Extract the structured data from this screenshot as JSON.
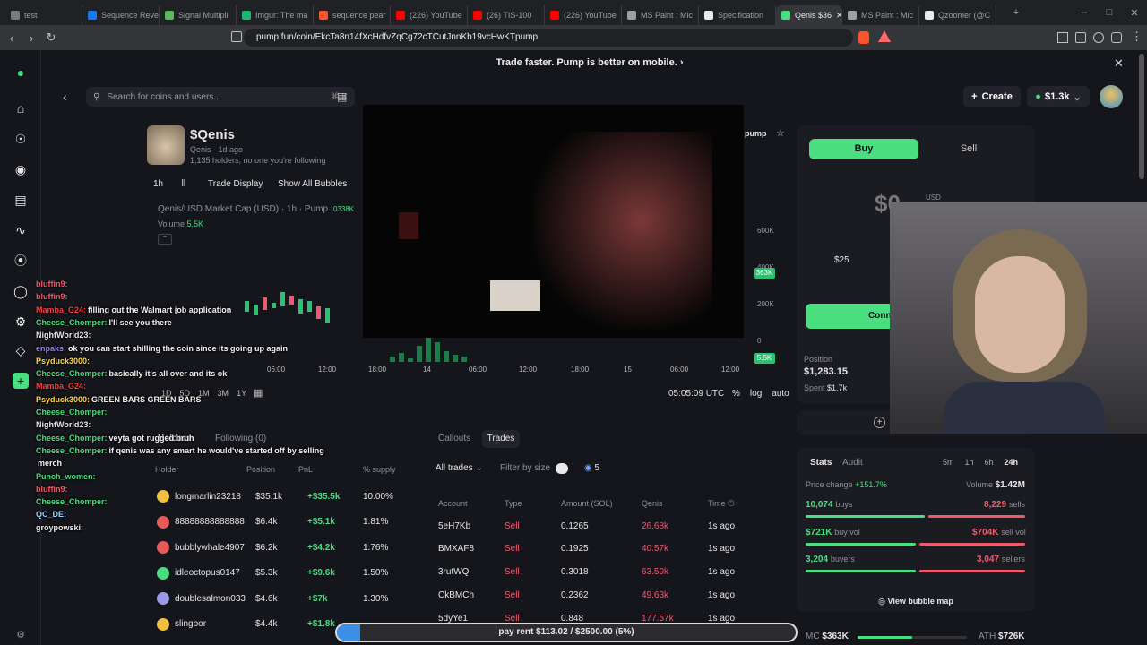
{
  "browser": {
    "tabs": [
      {
        "label": "test",
        "color": "#7a7a7a"
      },
      {
        "label": "Sequence Reve",
        "color": "#1877f2"
      },
      {
        "label": "Signal Multipli",
        "color": "#5cb85c"
      },
      {
        "label": "Imgur: The ma",
        "color": "#1bb76e"
      },
      {
        "label": "sequence pear",
        "color": "#fb542b"
      },
      {
        "label": "(226) YouTube",
        "color": "#ff0000"
      },
      {
        "label": "(26) TIS-100",
        "color": "#ff0000"
      },
      {
        "label": "(226) YouTube",
        "color": "#ff0000"
      },
      {
        "label": "MS Paint : Mic",
        "color": "#9aa0a6"
      },
      {
        "label": "Specification",
        "color": "#e8eaed"
      },
      {
        "label": "Qenis $36",
        "color": "#4ade80"
      },
      {
        "label": "MS Paint : Mic",
        "color": "#9aa0a6"
      },
      {
        "label": "Qzoomer (@C",
        "color": "#e8eaed"
      }
    ],
    "url": "pump.fun/coin/EkcTa8n14fXcHdfvZqCg72cTCutJnnKb19vcHwKTpump"
  },
  "banner": "Trade faster. Pump is better on mobile.",
  "search": {
    "placeholder": "Search for coins and users...",
    "shortcut": "⌘  K"
  },
  "header": {
    "create": "Create",
    "balance": "$1.3k"
  },
  "coin": {
    "ticker": "$Qenis",
    "name": "Qenis",
    "age": "1d ago",
    "holders": "1,135 holders, no one you're following",
    "tag": "pump"
  },
  "chart_bar": {
    "interval": "1h",
    "trade_display": "Trade Display",
    "bubbles": "Show All Bubbles",
    "pair": "Qenis/USD Market Cap (USD) · 1h · Pump",
    "mc_label": "0338K",
    "volume_label": "Volume",
    "volume": "5.5K"
  },
  "chart_data": {
    "type": "bar",
    "x_ticks": [
      "06:00",
      "12:00",
      "18:00",
      "14",
      "06:00",
      "12:00",
      "18:00",
      "15",
      "06:00",
      "12:00"
    ],
    "y_ticks": [
      "600K",
      "400K",
      "200K",
      "0"
    ],
    "last_price_tag": "363K",
    "volume_tag": "5.5K",
    "timeframes": [
      "1D",
      "5D",
      "1M",
      "3M",
      "1Y"
    ],
    "time": "05:05:09 UTC",
    "controls": [
      "%",
      "log",
      "auto"
    ]
  },
  "trade": {
    "buy": "Buy",
    "sell": "Sell",
    "amount": "$0",
    "unit": "USD",
    "quick": "$25",
    "connect": "Conn"
  },
  "position": {
    "label": "Position",
    "value": "$1,283.15",
    "spent_label": "Spent",
    "spent": "$1.7k"
  },
  "holders": {
    "tabs": [
      "Holders",
      "Following (0)"
    ],
    "headers": [
      "Holder",
      "Position",
      "PnL",
      "% supply"
    ],
    "rows": [
      {
        "name": "longmarlin23218",
        "position": "$35.1k",
        "pnl": "+$35.5k",
        "supply": "10.00%"
      },
      {
        "name": "88888888888888",
        "position": "$6.4k",
        "pnl": "+$5.1k",
        "supply": "1.81%"
      },
      {
        "name": "bubblywhale4907",
        "position": "$6.2k",
        "pnl": "+$4.2k",
        "supply": "1.76%"
      },
      {
        "name": "idleoctopus0147",
        "position": "$5.3k",
        "pnl": "+$9.6k",
        "supply": "1.50%"
      },
      {
        "name": "doublesalmon033",
        "position": "$4.6k",
        "pnl": "+$7k",
        "supply": "1.30%"
      },
      {
        "name": "slingoor",
        "position": "$4.4k",
        "pnl": "+$1.8k",
        "supply": ""
      }
    ]
  },
  "trades": {
    "tabs": [
      "Callouts",
      "Trades"
    ],
    "filter": "All trades",
    "size_label": "Filter by size",
    "size_value": "5",
    "headers": [
      "Account",
      "Type",
      "Amount (SOL)",
      "Qenis",
      "Time"
    ],
    "rows": [
      {
        "account": "5eH7Kb",
        "type": "Sell",
        "amount": "0.1265",
        "qenis": "26.68k",
        "time": "1s ago"
      },
      {
        "account": "BMXAF8",
        "type": "Sell",
        "amount": "0.1925",
        "qenis": "40.57k",
        "time": "1s ago"
      },
      {
        "account": "3rutWQ",
        "type": "Sell",
        "amount": "0.3018",
        "qenis": "63.50k",
        "time": "1s ago"
      },
      {
        "account": "CkBMCh",
        "type": "Sell",
        "amount": "0.2362",
        "qenis": "49.63k",
        "time": "1s ago"
      },
      {
        "account": "5dyYe1",
        "type": "Sell",
        "amount": "0.848",
        "qenis": "177.57k",
        "time": "1s ago"
      }
    ]
  },
  "stats": {
    "tabs": [
      "Stats",
      "Audit"
    ],
    "ranges": [
      "5m",
      "1h",
      "6h",
      "24h"
    ],
    "price_change_label": "Price change",
    "price_change": "+151.7%",
    "volume_label": "Volume",
    "volume": "$1.42M",
    "buys": "10,074",
    "buys_label": "buys",
    "sells": "8,229",
    "sells_label": "sells",
    "buy_vol": "$721K",
    "buy_vol_label": "buy vol",
    "sell_vol": "$704K",
    "sell_vol_label": "sell vol",
    "buyers": "3,204",
    "buyers_label": "buyers",
    "sellers": "3,047",
    "sellers_label": "sellers",
    "buy_ratio": 0.55,
    "buyvol_ratio": 0.51,
    "buyers_ratio": 0.51,
    "bubble_map": "View bubble map",
    "mc_label": "MC",
    "mc": "$363K",
    "ath_label": "ATH",
    "ath": "$726K",
    "mc_ratio": 0.5
  },
  "goal": {
    "text": "pay rent $113.02 / $2500.00 (5%)",
    "percent": 5
  },
  "chat": [
    {
      "user": "bluffin9:",
      "color": "#f05a6e",
      "msg": ""
    },
    {
      "user": "bluffin9:",
      "color": "#f05a6e",
      "msg": ""
    },
    {
      "user": "Mamba_G24:",
      "color": "#ff3b3b",
      "msg": "filling out the Walmart job application"
    },
    {
      "user": "Cheese_Chomper:",
      "color": "#4ade80",
      "msg": "I'll see you there"
    },
    {
      "user": "NightWorld23:",
      "color": "#e8e8e8",
      "msg": ""
    },
    {
      "user": "enpaks:",
      "color": "#9a7bff",
      "msg": "ok you can start shilling the coin since its going up again"
    },
    {
      "user": "Psyduck3000:",
      "color": "#ffd84a",
      "msg": ""
    },
    {
      "user": "Cheese_Chomper:",
      "color": "#4ade80",
      "msg": "basically it's all over and its ok"
    },
    {
      "user": "Mamba_G24:",
      "color": "#ff3b3b",
      "msg": ""
    },
    {
      "user": "Psyduck3000:",
      "color": "#ffd84a",
      "msg": "GREEN BARS GREEN BARS"
    },
    {
      "user": "Cheese_Chomper:",
      "color": "#4ade80",
      "msg": ""
    },
    {
      "user": "NightWorld23:",
      "color": "#e8e8e8",
      "msg": ""
    },
    {
      "user": "Cheese_Chomper:",
      "color": "#4ade80",
      "msg": "veyta got rugged bruh"
    },
    {
      "user": "Cheese_Chomper:",
      "color": "#4ade80",
      "msg": "if qenis was any smart he would've started off by selling"
    },
    {
      "user": "",
      "color": "#e8e8e8",
      "msg": "merch"
    },
    {
      "user": "Punch_women:",
      "color": "#4ade80",
      "msg": ""
    },
    {
      "user": "bluffin9:",
      "color": "#f05a6e",
      "msg": ""
    },
    {
      "user": "Cheese_Chomper:",
      "color": "#4ade80",
      "msg": ""
    },
    {
      "user": "QC_DE:",
      "color": "#9ad0ff",
      "msg": ""
    },
    {
      "user": "groypowski:",
      "color": "#e8e8e8",
      "msg": ""
    }
  ]
}
